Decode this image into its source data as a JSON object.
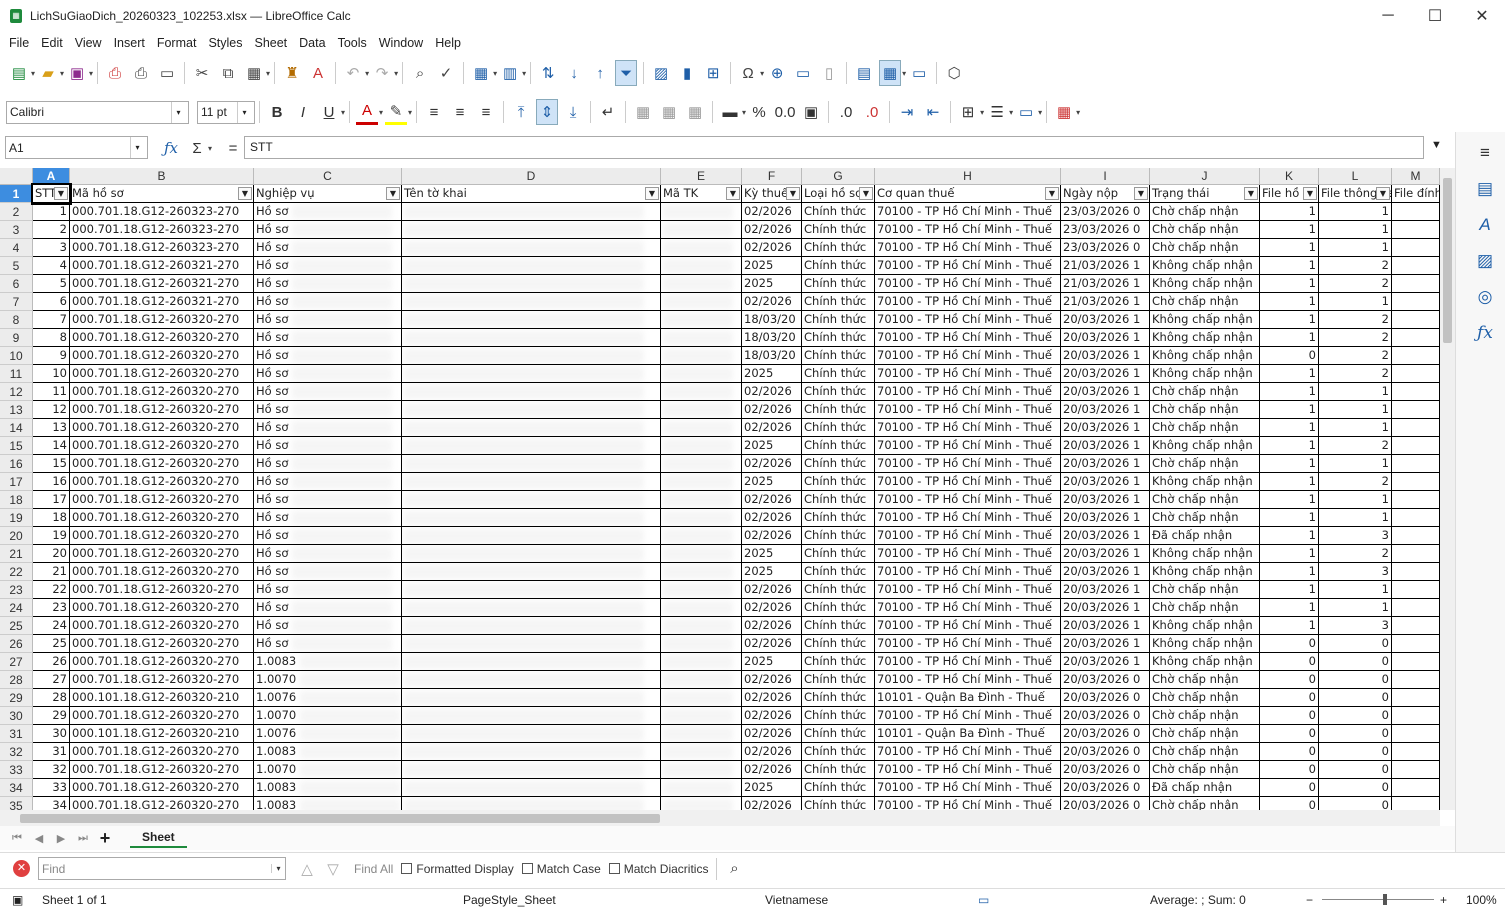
{
  "window": {
    "title": "LichSuGiaoDich_20260323_102253.xlsx — LibreOffice Calc",
    "minimize": "─",
    "maximize": "☐",
    "close": "✕"
  },
  "menu": [
    "File",
    "Edit",
    "View",
    "Insert",
    "Format",
    "Styles",
    "Sheet",
    "Data",
    "Tools",
    "Window",
    "Help"
  ],
  "font": {
    "name": "Calibri",
    "size": "11 pt"
  },
  "formula": {
    "cell_ref": "A1",
    "content": "STT"
  },
  "columns": [
    "A",
    "B",
    "C",
    "D",
    "E",
    "F",
    "G",
    "H",
    "I",
    "J",
    "K",
    "L",
    "M"
  ],
  "headers": [
    "STT",
    "Mã hồ sơ",
    "Nghiệp vụ",
    "Tên tờ khai",
    "Mã TK",
    "Kỳ thuế",
    "Loại hồ sơ",
    "Cơ quan thuế",
    "Ngày nộp",
    "Trạng thái",
    "File hồ sơ",
    "File thông báo",
    "File đính kèm"
  ],
  "rows": [
    {
      "stt": "1",
      "ma": "000.701.18.G12-260323-270",
      "nv": "Hồ sơ",
      "ky": "02/2026",
      "loai": "Chính thức",
      "cq": "70100 - TP Hồ Chí Minh - Thuế",
      "ngay": "23/03/2026 0",
      "tt": "Chờ chấp nhận",
      "k": "1",
      "l": "1"
    },
    {
      "stt": "2",
      "ma": "000.701.18.G12-260323-270",
      "nv": "Hồ sơ",
      "ky": "02/2026",
      "loai": "Chính thức",
      "cq": "70100 - TP Hồ Chí Minh - Thuế",
      "ngay": "23/03/2026 0",
      "tt": "Chờ chấp nhận",
      "k": "1",
      "l": "1"
    },
    {
      "stt": "3",
      "ma": "000.701.18.G12-260323-270",
      "nv": "Hồ sơ",
      "ky": "02/2026",
      "loai": "Chính thức",
      "cq": "70100 - TP Hồ Chí Minh - Thuế",
      "ngay": "23/03/2026 0",
      "tt": "Chờ chấp nhận",
      "k": "1",
      "l": "1"
    },
    {
      "stt": "4",
      "ma": "000.701.18.G12-260321-270",
      "nv": "Hồ sơ",
      "ky": "2025",
      "loai": "Chính thức",
      "cq": "70100 - TP Hồ Chí Minh - Thuế",
      "ngay": "21/03/2026 1",
      "tt": "Không chấp nhận",
      "k": "1",
      "l": "2"
    },
    {
      "stt": "5",
      "ma": "000.701.18.G12-260321-270",
      "nv": "Hồ sơ",
      "ky": "2025",
      "loai": "Chính thức",
      "cq": "70100 - TP Hồ Chí Minh - Thuế",
      "ngay": "21/03/2026 1",
      "tt": "Không chấp nhận",
      "k": "1",
      "l": "2"
    },
    {
      "stt": "6",
      "ma": "000.701.18.G12-260321-270",
      "nv": "Hồ sơ",
      "ky": "02/2026",
      "loai": "Chính thức",
      "cq": "70100 - TP Hồ Chí Minh - Thuế",
      "ngay": "21/03/2026 1",
      "tt": "Chờ chấp nhận",
      "k": "1",
      "l": "1"
    },
    {
      "stt": "7",
      "ma": "000.701.18.G12-260320-270",
      "nv": "Hồ sơ",
      "ky": "18/03/20",
      "loai": "Chính thức",
      "cq": "70100 - TP Hồ Chí Minh - Thuế",
      "ngay": "20/03/2026 1",
      "tt": "Không chấp nhận",
      "k": "1",
      "l": "2"
    },
    {
      "stt": "8",
      "ma": "000.701.18.G12-260320-270",
      "nv": "Hồ sơ",
      "ky": "18/03/20",
      "loai": "Chính thức",
      "cq": "70100 - TP Hồ Chí Minh - Thuế",
      "ngay": "20/03/2026 1",
      "tt": "Không chấp nhận",
      "k": "1",
      "l": "2"
    },
    {
      "stt": "9",
      "ma": "000.701.18.G12-260320-270",
      "nv": "Hồ sơ",
      "ky": "18/03/20",
      "loai": "Chính thức",
      "cq": "70100 - TP Hồ Chí Minh - Thuế",
      "ngay": "20/03/2026 1",
      "tt": "Không chấp nhận",
      "k": "0",
      "l": "2"
    },
    {
      "stt": "10",
      "ma": "000.701.18.G12-260320-270",
      "nv": "Hồ sơ",
      "ky": "2025",
      "loai": "Chính thức",
      "cq": "70100 - TP Hồ Chí Minh - Thuế",
      "ngay": "20/03/2026 1",
      "tt": "Không chấp nhận",
      "k": "1",
      "l": "2"
    },
    {
      "stt": "11",
      "ma": "000.701.18.G12-260320-270",
      "nv": "Hồ sơ",
      "ky": "02/2026",
      "loai": "Chính thức",
      "cq": "70100 - TP Hồ Chí Minh - Thuế",
      "ngay": "20/03/2026 1",
      "tt": "Chờ chấp nhận",
      "k": "1",
      "l": "1"
    },
    {
      "stt": "12",
      "ma": "000.701.18.G12-260320-270",
      "nv": "Hồ sơ",
      "ky": "02/2026",
      "loai": "Chính thức",
      "cq": "70100 - TP Hồ Chí Minh - Thuế",
      "ngay": "20/03/2026 1",
      "tt": "Chờ chấp nhận",
      "k": "1",
      "l": "1"
    },
    {
      "stt": "13",
      "ma": "000.701.18.G12-260320-270",
      "nv": "Hồ sơ",
      "ky": "02/2026",
      "loai": "Chính thức",
      "cq": "70100 - TP Hồ Chí Minh - Thuế",
      "ngay": "20/03/2026 1",
      "tt": "Chờ chấp nhận",
      "k": "1",
      "l": "1"
    },
    {
      "stt": "14",
      "ma": "000.701.18.G12-260320-270",
      "nv": "Hồ sơ",
      "ky": "2025",
      "loai": "Chính thức",
      "cq": "70100 - TP Hồ Chí Minh - Thuế",
      "ngay": "20/03/2026 1",
      "tt": "Không chấp nhận",
      "k": "1",
      "l": "2"
    },
    {
      "stt": "15",
      "ma": "000.701.18.G12-260320-270",
      "nv": "Hồ sơ",
      "ky": "02/2026",
      "loai": "Chính thức",
      "cq": "70100 - TP Hồ Chí Minh - Thuế",
      "ngay": "20/03/2026 1",
      "tt": "Chờ chấp nhận",
      "k": "1",
      "l": "1"
    },
    {
      "stt": "16",
      "ma": "000.701.18.G12-260320-270",
      "nv": "Hồ sơ",
      "ky": "2025",
      "loai": "Chính thức",
      "cq": "70100 - TP Hồ Chí Minh - Thuế",
      "ngay": "20/03/2026 1",
      "tt": "Không chấp nhận",
      "k": "1",
      "l": "2"
    },
    {
      "stt": "17",
      "ma": "000.701.18.G12-260320-270",
      "nv": "Hồ sơ",
      "ky": "02/2026",
      "loai": "Chính thức",
      "cq": "70100 - TP Hồ Chí Minh - Thuế",
      "ngay": "20/03/2026 1",
      "tt": "Chờ chấp nhận",
      "k": "1",
      "l": "1"
    },
    {
      "stt": "18",
      "ma": "000.701.18.G12-260320-270",
      "nv": "Hồ sơ",
      "ky": "02/2026",
      "loai": "Chính thức",
      "cq": "70100 - TP Hồ Chí Minh - Thuế",
      "ngay": "20/03/2026 1",
      "tt": "Chờ chấp nhận",
      "k": "1",
      "l": "1"
    },
    {
      "stt": "19",
      "ma": "000.701.18.G12-260320-270",
      "nv": "Hồ sơ",
      "ky": "02/2026",
      "loai": "Chính thức",
      "cq": "70100 - TP Hồ Chí Minh - Thuế",
      "ngay": "20/03/2026 1",
      "tt": "Đã chấp nhận",
      "k": "1",
      "l": "3"
    },
    {
      "stt": "20",
      "ma": "000.701.18.G12-260320-270",
      "nv": "Hồ sơ",
      "ky": "2025",
      "loai": "Chính thức",
      "cq": "70100 - TP Hồ Chí Minh - Thuế",
      "ngay": "20/03/2026 1",
      "tt": "Không chấp nhận",
      "k": "1",
      "l": "2"
    },
    {
      "stt": "21",
      "ma": "000.701.18.G12-260320-270",
      "nv": "Hồ sơ",
      "ky": "2025",
      "loai": "Chính thức",
      "cq": "70100 - TP Hồ Chí Minh - Thuế",
      "ngay": "20/03/2026 1",
      "tt": "Không chấp nhận",
      "k": "1",
      "l": "3"
    },
    {
      "stt": "22",
      "ma": "000.701.18.G12-260320-270",
      "nv": "Hồ sơ",
      "ky": "02/2026",
      "loai": "Chính thức",
      "cq": "70100 - TP Hồ Chí Minh - Thuế",
      "ngay": "20/03/2026 1",
      "tt": "Chờ chấp nhận",
      "k": "1",
      "l": "1"
    },
    {
      "stt": "23",
      "ma": "000.701.18.G12-260320-270",
      "nv": "Hồ sơ",
      "ky": "02/2026",
      "loai": "Chính thức",
      "cq": "70100 - TP Hồ Chí Minh - Thuế",
      "ngay": "20/03/2026 1",
      "tt": "Chờ chấp nhận",
      "k": "1",
      "l": "1"
    },
    {
      "stt": "24",
      "ma": "000.701.18.G12-260320-270",
      "nv": "Hồ sơ",
      "ky": "02/2026",
      "loai": "Chính thức",
      "cq": "70100 - TP Hồ Chí Minh - Thuế",
      "ngay": "20/03/2026 1",
      "tt": "Không chấp nhận",
      "k": "1",
      "l": "3"
    },
    {
      "stt": "25",
      "ma": "000.701.18.G12-260320-270",
      "nv": "Hồ sơ",
      "ky": "02/2026",
      "loai": "Chính thức",
      "cq": "70100 - TP Hồ Chí Minh - Thuế",
      "ngay": "20/03/2026 1",
      "tt": "Không chấp nhận",
      "k": "0",
      "l": "0"
    },
    {
      "stt": "26",
      "ma": "000.701.18.G12-260320-270",
      "nv": "1.0083",
      "ky": "2025",
      "loai": "Chính thức",
      "cq": "70100 - TP Hồ Chí Minh - Thuế",
      "ngay": "20/03/2026 1",
      "tt": "Không chấp nhận",
      "k": "0",
      "l": "0"
    },
    {
      "stt": "27",
      "ma": "000.701.18.G12-260320-270",
      "nv": "1.0070",
      "ky": "02/2026",
      "loai": "Chính thức",
      "cq": "70100 - TP Hồ Chí Minh - Thuế",
      "ngay": "20/03/2026 0",
      "tt": "Chờ chấp nhận",
      "k": "0",
      "l": "0"
    },
    {
      "stt": "28",
      "ma": "000.101.18.G12-260320-210",
      "nv": "1.0076",
      "ky": "02/2026",
      "loai": "Chính thức",
      "cq": "10101 - Quận Ba Đình - Thuế",
      "ngay": "20/03/2026 0",
      "tt": "Chờ chấp nhận",
      "k": "0",
      "l": "0"
    },
    {
      "stt": "29",
      "ma": "000.701.18.G12-260320-270",
      "nv": "1.0070",
      "ky": "02/2026",
      "loai": "Chính thức",
      "cq": "70100 - TP Hồ Chí Minh - Thuế",
      "ngay": "20/03/2026 0",
      "tt": "Chờ chấp nhận",
      "k": "0",
      "l": "0"
    },
    {
      "stt": "30",
      "ma": "000.101.18.G12-260320-210",
      "nv": "1.0076",
      "ky": "02/2026",
      "loai": "Chính thức",
      "cq": "10101 - Quận Ba Đình - Thuế",
      "ngay": "20/03/2026 0",
      "tt": "Chờ chấp nhận",
      "k": "0",
      "l": "0"
    },
    {
      "stt": "31",
      "ma": "000.701.18.G12-260320-270",
      "nv": "1.0083",
      "ky": "02/2026",
      "loai": "Chính thức",
      "cq": "70100 - TP Hồ Chí Minh - Thuế",
      "ngay": "20/03/2026 0",
      "tt": "Chờ chấp nhận",
      "k": "0",
      "l": "0"
    },
    {
      "stt": "32",
      "ma": "000.701.18.G12-260320-270",
      "nv": "1.0070",
      "ky": "02/2026",
      "loai": "Chính thức",
      "cq": "70100 - TP Hồ Chí Minh - Thuế",
      "ngay": "20/03/2026 0",
      "tt": "Chờ chấp nhận",
      "k": "0",
      "l": "0"
    },
    {
      "stt": "33",
      "ma": "000.701.18.G12-260320-270",
      "nv": "1.0083",
      "ky": "2025",
      "loai": "Chính thức",
      "cq": "70100 - TP Hồ Chí Minh - Thuế",
      "ngay": "20/03/2026 0",
      "tt": "Đã chấp nhận",
      "k": "0",
      "l": "0"
    },
    {
      "stt": "34",
      "ma": "000.701.18.G12-260320-270",
      "nv": "1.0083",
      "ky": "02/2026",
      "loai": "Chính thức",
      "cq": "70100 - TP Hồ Chí Minh - Thuế",
      "ngay": "20/03/2026 0",
      "tt": "Chờ chấp nhận",
      "k": "0",
      "l": "0"
    }
  ],
  "sheet_tab": "Sheet",
  "find": {
    "placeholder": "Find",
    "find_all": "Find All",
    "formatted_display": "Formatted Display",
    "match_case": "Match Case",
    "match_diacritics": "Match Diacritics"
  },
  "status": {
    "sheet": "Sheet 1 of 1",
    "page_style": "PageStyle_Sheet",
    "language": "Vietnamese",
    "summary": "Average: ; Sum: 0",
    "zoom": "100%"
  }
}
